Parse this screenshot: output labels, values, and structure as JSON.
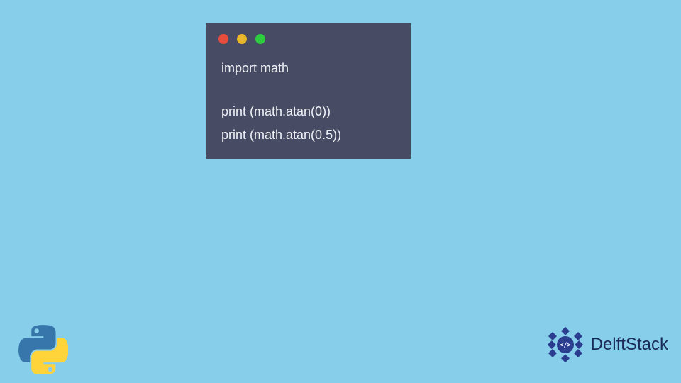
{
  "code": {
    "lines": [
      "import math",
      "",
      "print (math.atan(0))",
      "print (math.atan(0.5))"
    ]
  },
  "window": {
    "dots": {
      "red": "#e74c3c",
      "yellow": "#e8b82a",
      "green": "#2ecc40"
    }
  },
  "brand": {
    "name": "DelftStack"
  },
  "colors": {
    "background": "#87ceeb",
    "code_window": "#474b63",
    "code_text": "#eef0f5",
    "brand_text": "#1a2a5a",
    "brand_icon": "#2a3d8f"
  }
}
